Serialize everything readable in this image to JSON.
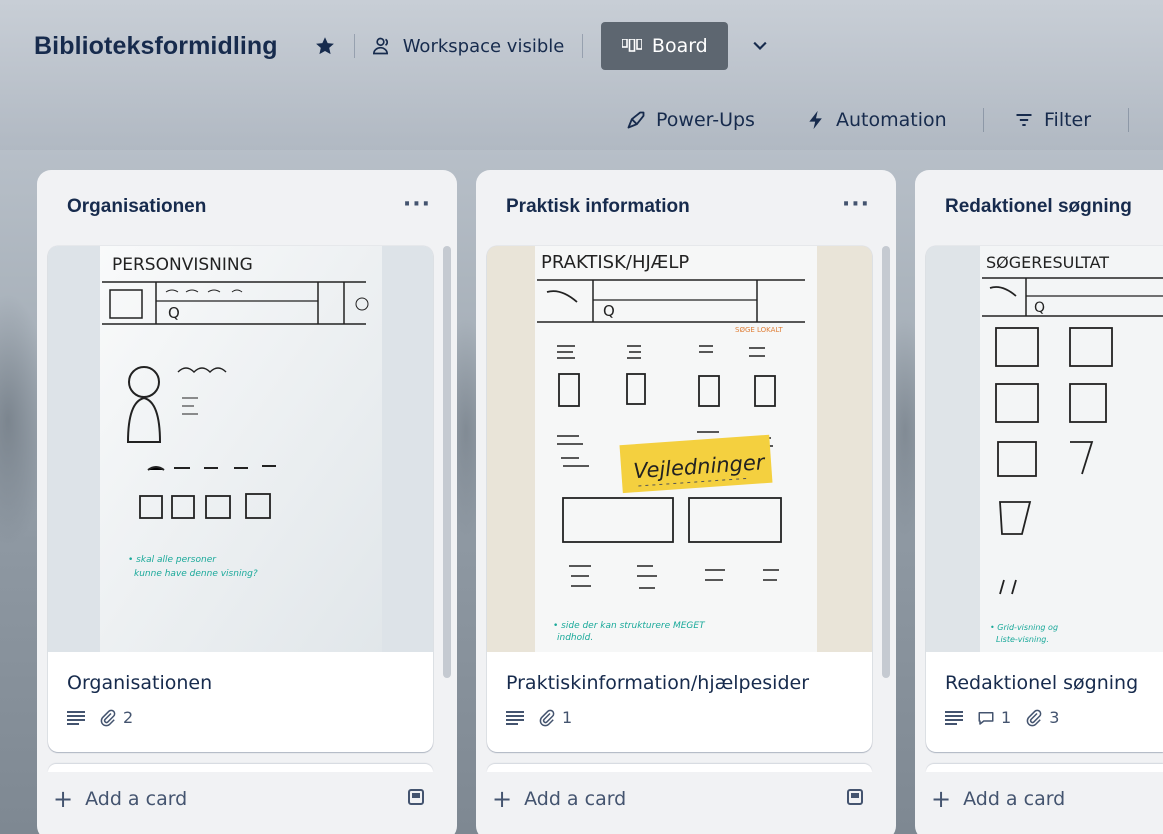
{
  "header": {
    "board_title": "Biblioteksformidling",
    "visibility_label": "Workspace visible",
    "view_label": "Board",
    "powerups_label": "Power-Ups",
    "automation_label": "Automation",
    "filter_label": "Filter"
  },
  "lists": [
    {
      "title": "Organisationen",
      "menu": "···",
      "card": {
        "cover_text": [
          "PERSONVISNING",
          "Q",
          "• skal alle personer",
          "kunne have denne visning?"
        ],
        "title": "Organisationen",
        "attachments": "2"
      },
      "add_card_label": "Add a card"
    },
    {
      "title": "Praktisk information",
      "menu": "···",
      "card": {
        "cover_text": [
          "PRAKTISK/HJÆLP",
          "Q",
          "SØGE LOKALT",
          "Vejledninger",
          "• side der kan strukturere MEGET",
          "indhold."
        ],
        "title": "Praktiskinformation/hjælpesider",
        "attachments": "1"
      },
      "add_card_label": "Add a card"
    },
    {
      "title": "Redaktionel søgning",
      "menu": "···",
      "card": {
        "cover_text": [
          "SØGERESULTAT",
          "Q",
          "• Grid-visning og",
          "Liste-visning."
        ],
        "title": "Redaktionel søgning",
        "comments": "1",
        "attachments": "3"
      },
      "add_card_label": "Add a card"
    }
  ],
  "colors": {
    "board_button": "#5d6670",
    "list_bg": "#f1f2f4",
    "text": "#172b4d",
    "sticky_note": "#f4d03f",
    "marker_teal": "#1aa99a"
  }
}
